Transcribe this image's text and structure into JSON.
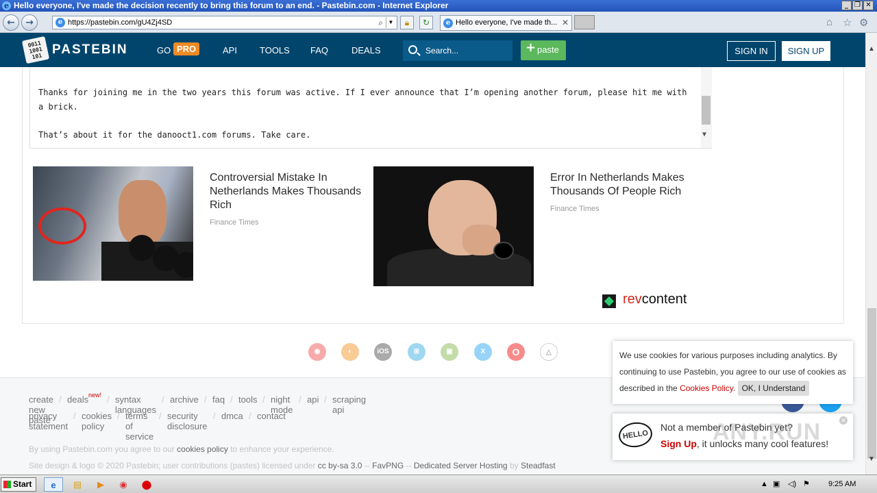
{
  "window": {
    "title": "Hello everyone, I've made the decision recently to bring this forum to an end. - Pastebin.com - Internet Explorer"
  },
  "browser": {
    "address": "https://pastebin.com/gU4Zj4SD",
    "tab_title": "Hello everyone, I've made th...",
    "icons": [
      "back-icon",
      "forward-icon",
      "search-icon",
      "lock-icon",
      "refresh-icon",
      "home-icon",
      "favorites-icon",
      "tools-icon"
    ]
  },
  "header": {
    "brand": "PASTEBIN",
    "nav": {
      "go": "GO",
      "pro": "PRO",
      "api": "API",
      "tools": "TOOLS",
      "faq": "FAQ",
      "deals": "DEALS"
    },
    "search_placeholder": "Search...",
    "paste_label": "paste",
    "signin": "SIGN IN",
    "signup": "SIGN UP",
    "bg_color": "#02456c",
    "paste_color": "#5cb85c",
    "pro_color": "#f08a24"
  },
  "code": {
    "line1": "Thanks for joining me in the two years this forum was active. If I ever announce that I’m opening another forum, please hit me with",
    "line2": "a brick.",
    "line3": "That’s about it for the danooct1.com forums. Take care."
  },
  "ads": [
    {
      "title": "Controversial Mistake In Netherlands Makes Thousands Rich",
      "source": "Finance Times"
    },
    {
      "title": "Error In Netherlands Makes Thousands Of People Rich",
      "source": "Finance Times"
    }
  ],
  "revcontent": {
    "prefix": "rev",
    "suffix": "content"
  },
  "browser_icons": [
    "chrome-icon",
    "firefox-icon",
    "ios-icon",
    "windows-icon",
    "android-icon",
    "twitter-icon",
    "opera-icon",
    "linux-icon"
  ],
  "footer": {
    "links_row1": [
      "create new paste",
      "deals",
      "syntax languages",
      "archive",
      "faq",
      "tools",
      "night mode",
      "api",
      "scraping api"
    ],
    "deals_badge": "new!",
    "links_row2": [
      "privacy statement",
      "cookies policy",
      "terms of service",
      "security disclosure",
      "dmca",
      "contact"
    ],
    "note1_pre": "By using Pastebin.com you agree to our",
    "note1_link": "cookies policy",
    "note1_post": "to enhance your experience.",
    "note2_pre": "Site design & logo © 2020 Pastebin; user contributions (pastes) licensed under",
    "note2_link1": "cc by-sa 3.0",
    "note2_sep1": "--",
    "note2_link2": "FavPNG",
    "note2_sep2": "--",
    "note2_link3": "Dedicated Server Hosting",
    "note2_by": "by",
    "note2_link4": "Steadfast"
  },
  "cookie": {
    "text": "We use cookies for various purposes including analytics. By continuing to use Pastebin, you agree to our use of cookies as described in the",
    "link": "Cookies Policy",
    "button": "OK, I Understand"
  },
  "member": {
    "badge": "HELLO",
    "line1": "Not a member of Pastebin yet?",
    "signup": "Sign Up",
    "line2": ", it unlocks many cool features!"
  },
  "watermark": "ANY.RUN",
  "taskbar": {
    "start": "Start",
    "clock": "9:25 AM"
  }
}
